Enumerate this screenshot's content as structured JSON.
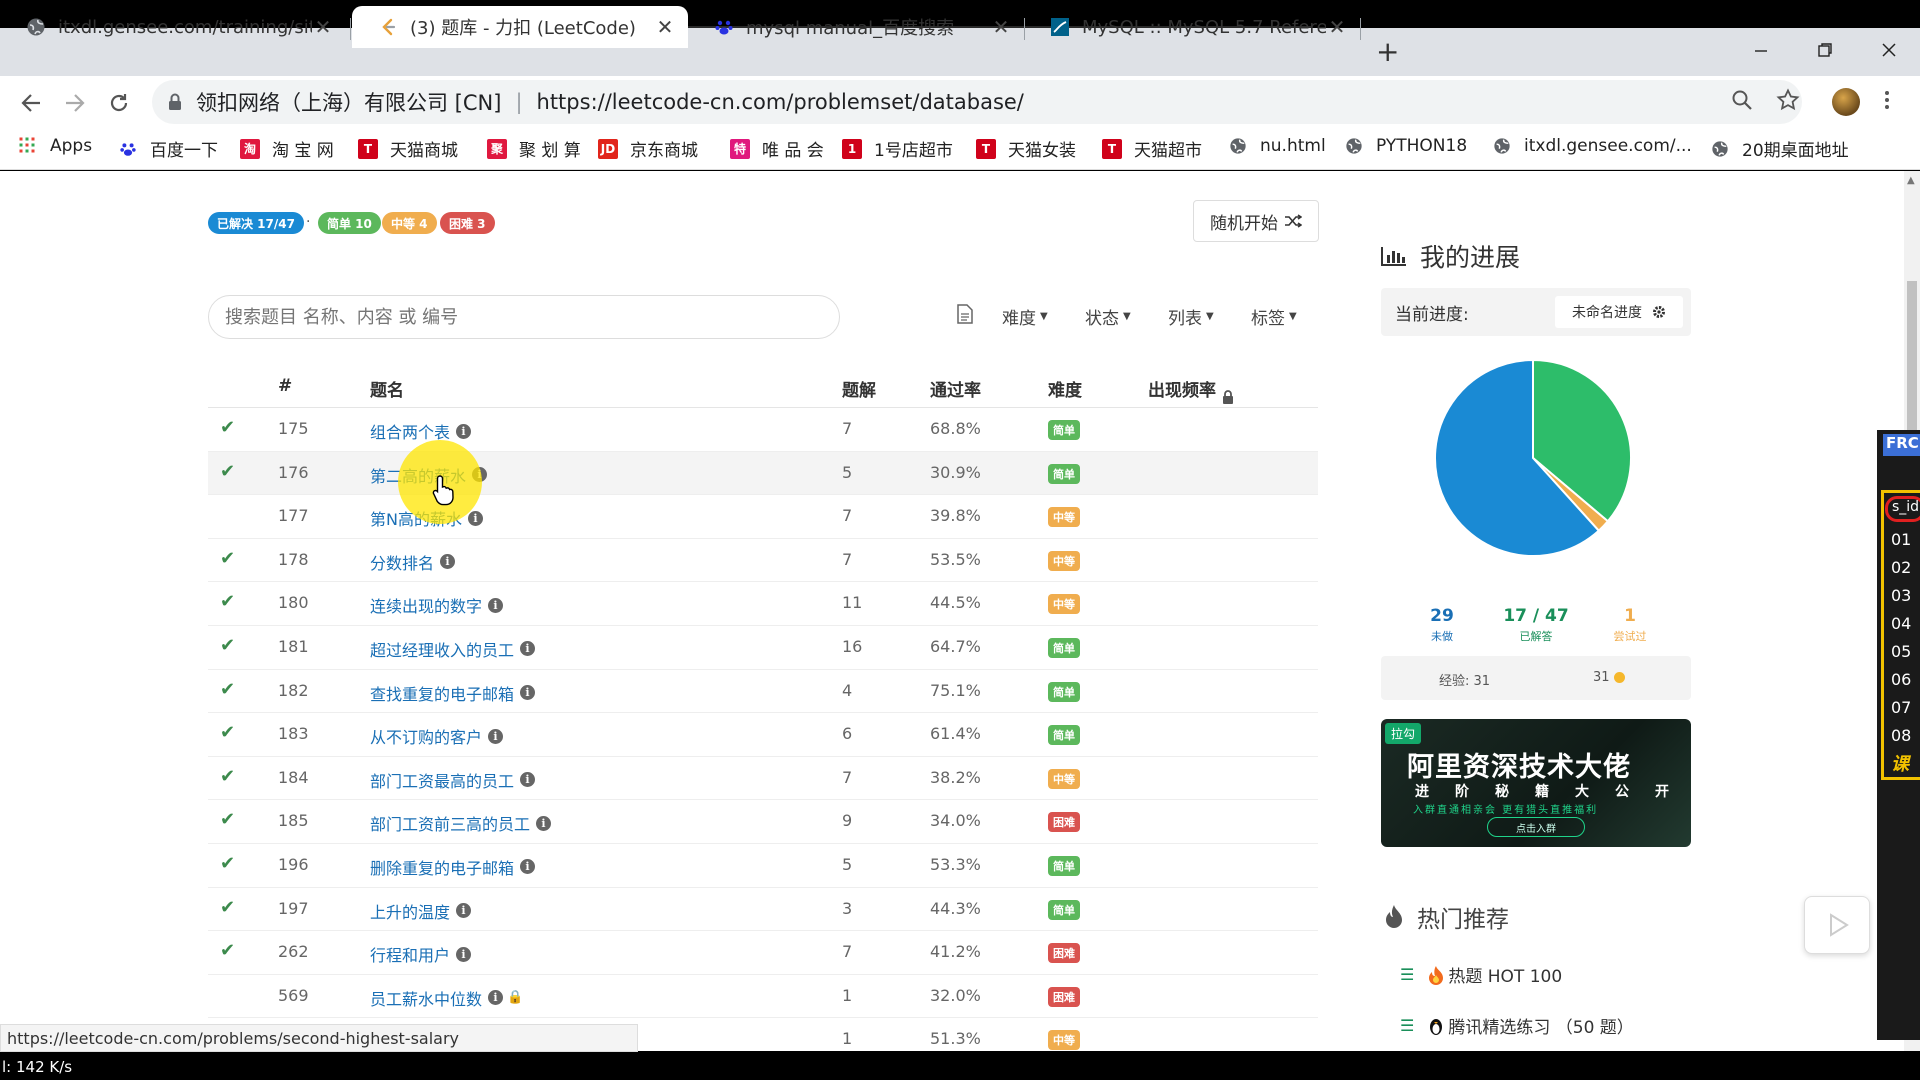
{
  "browser": {
    "tabs": [
      {
        "title": "itxdl.gensee.com/training/site...",
        "favicon": "globe-icon"
      },
      {
        "title": "(3) 题库 - 力扣 (LeetCode)",
        "favicon": "leetcode-icon",
        "active": true
      },
      {
        "title": "mysql manual_百度搜索",
        "favicon": "baidu-paw-icon"
      },
      {
        "title": "MySQL :: MySQL 5.7 Reference",
        "favicon": "mysql-icon"
      }
    ],
    "close_glyph": "✕",
    "new_tab_glyph": "+",
    "address": {
      "org": "领扣网络（上海）有限公司 [CN]",
      "separator": "|",
      "url": "https://leetcode-cn.com/problemset/database/"
    },
    "bookmarks": [
      {
        "label": "Apps",
        "icon": "apps-grid-icon"
      },
      {
        "label": "百度一下",
        "icon": "baidu-paw-icon"
      },
      {
        "label": "淘 宝 网",
        "icon": "taobao-icon"
      },
      {
        "label": "天猫商城",
        "icon": "tmall-icon"
      },
      {
        "label": "聚 划 算",
        "icon": "juhuasuan-icon"
      },
      {
        "label": "京东商城",
        "icon": "jd-icon"
      },
      {
        "label": "唯 品 会",
        "icon": "vip-icon"
      },
      {
        "label": "1号店超市",
        "icon": "yhd-icon"
      },
      {
        "label": "天猫女装",
        "icon": "tmall-icon"
      },
      {
        "label": "天猫超市",
        "icon": "tmall-icon"
      },
      {
        "label": "nu.html",
        "icon": "globe-icon"
      },
      {
        "label": "PYTHON18",
        "icon": "globe-icon"
      },
      {
        "label": "itxdl.gensee.com/...",
        "icon": "globe-icon"
      },
      {
        "label": "20期桌面地址",
        "icon": "globe-icon"
      }
    ]
  },
  "stats": {
    "solved": "已解决 17/47",
    "dot": "·",
    "easy": "简单 10",
    "medium": "中等 4",
    "hard": "困难 3"
  },
  "random_button": "随机开始",
  "search": {
    "placeholder": "搜索题目 名称、内容 或 编号"
  },
  "filters": {
    "difficulty": "难度",
    "status": "状态",
    "list": "列表",
    "tags": "标签"
  },
  "table": {
    "headers": {
      "id": "#",
      "title": "题名",
      "solutions": "题解",
      "rate": "通过率",
      "difficulty": "难度",
      "frequency": "出现频率"
    },
    "rows": [
      {
        "solved": true,
        "id": "175",
        "title": "组合两个表",
        "solutions": "7",
        "rate": "68.8%",
        "difficulty": "简单",
        "level": "easy"
      },
      {
        "solved": true,
        "id": "176",
        "title": "第二高的薪水",
        "solutions": "5",
        "rate": "30.9%",
        "difficulty": "简单",
        "level": "easy"
      },
      {
        "solved": false,
        "id": "177",
        "title": "第N高的薪水",
        "solutions": "7",
        "rate": "39.8%",
        "difficulty": "中等",
        "level": "medium"
      },
      {
        "solved": true,
        "id": "178",
        "title": "分数排名",
        "solutions": "7",
        "rate": "53.5%",
        "difficulty": "中等",
        "level": "medium"
      },
      {
        "solved": true,
        "id": "180",
        "title": "连续出现的数字",
        "solutions": "11",
        "rate": "44.5%",
        "difficulty": "中等",
        "level": "medium"
      },
      {
        "solved": true,
        "id": "181",
        "title": "超过经理收入的员工",
        "solutions": "16",
        "rate": "64.7%",
        "difficulty": "简单",
        "level": "easy"
      },
      {
        "solved": true,
        "id": "182",
        "title": "查找重复的电子邮箱",
        "solutions": "4",
        "rate": "75.1%",
        "difficulty": "简单",
        "level": "easy"
      },
      {
        "solved": true,
        "id": "183",
        "title": "从不订购的客户",
        "solutions": "6",
        "rate": "61.4%",
        "difficulty": "简单",
        "level": "easy"
      },
      {
        "solved": true,
        "id": "184",
        "title": "部门工资最高的员工",
        "solutions": "7",
        "rate": "38.2%",
        "difficulty": "中等",
        "level": "medium"
      },
      {
        "solved": true,
        "id": "185",
        "title": "部门工资前三高的员工",
        "solutions": "9",
        "rate": "34.0%",
        "difficulty": "困难",
        "level": "hard"
      },
      {
        "solved": true,
        "id": "196",
        "title": "删除重复的电子邮箱",
        "solutions": "5",
        "rate": "53.3%",
        "difficulty": "简单",
        "level": "easy"
      },
      {
        "solved": true,
        "id": "197",
        "title": "上升的温度",
        "solutions": "3",
        "rate": "44.3%",
        "difficulty": "简单",
        "level": "easy"
      },
      {
        "solved": true,
        "id": "262",
        "title": "行程和用户",
        "solutions": "7",
        "rate": "41.2%",
        "difficulty": "困难",
        "level": "hard"
      },
      {
        "solved": false,
        "id": "569",
        "title": "员工薪水中位数",
        "solutions": "1",
        "rate": "32.0%",
        "difficulty": "困难",
        "level": "hard",
        "locked": true
      },
      {
        "solved": false,
        "id": "",
        "title": "",
        "solutions": "1",
        "rate": "51.3%",
        "difficulty": "中等",
        "level": "medium"
      }
    ]
  },
  "progress": {
    "title": "我的进展",
    "current_label": "当前进度:",
    "session": "未命名进度",
    "unsolved_count": "29",
    "unsolved_label": "未做",
    "solved_count": "17 / 47",
    "solved_label": "已解答",
    "attempted_count": "1",
    "attempted_label": "尝试过",
    "experience": "经验: 31",
    "coins": "31",
    "pie": {
      "unsolved": 29,
      "solved": 17,
      "attempted": 1
    }
  },
  "banner": {
    "tag": "拉勾",
    "headline": "阿里资深技术大佬",
    "sub": "进阶秘籍大公开",
    "note": "入群直通相亲会 更有猎头直推福利",
    "button": "点击入群"
  },
  "hot": {
    "title": "热门推荐",
    "items": [
      {
        "label": "热题 HOT 100",
        "icon": "fire-icon"
      },
      {
        "label": "腾讯精选练习 （50 题）",
        "icon": "penguin-icon"
      }
    ]
  },
  "status_url": "https://leetcode-cn.com/problems/second-highest-salary",
  "bottom_speed": "l: 142 K/s",
  "side_overlay": {
    "header": "FRC",
    "field": "s_id",
    "rows": [
      "01",
      "02",
      "03",
      "04",
      "05",
      "06",
      "07",
      "08"
    ],
    "footer": "课"
  },
  "colors": {
    "easy": "#5cb85c",
    "medium": "#f0ad4e",
    "hard": "#d9534f",
    "solved_pill": "#1a8ad4",
    "link": "#1a6fb5",
    "pie_unsolved": "#1a8ad4",
    "pie_solved": "#2dbd6a",
    "pie_attempted": "#f0ad4e"
  }
}
